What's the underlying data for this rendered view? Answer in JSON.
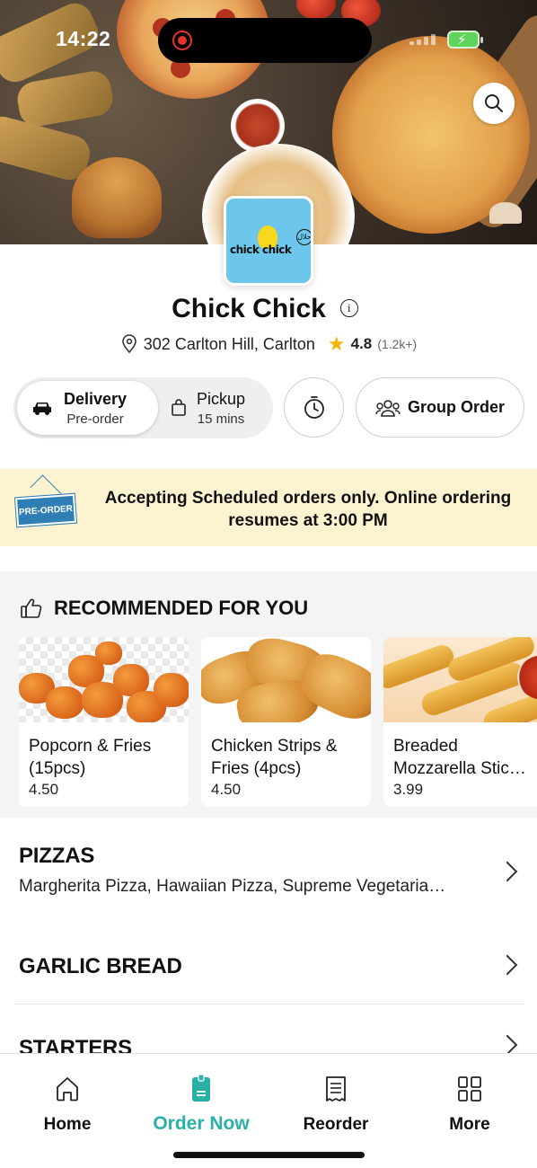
{
  "status_bar": {
    "time": "14:22",
    "battery_state": "charging"
  },
  "hero": {
    "search_icon": "search-icon"
  },
  "restaurant": {
    "logo_text": "chick chick",
    "name": "Chick Chick",
    "address": "302 Carlton Hill, Carlton",
    "rating": "4.8",
    "rating_count": "(1.2k+)"
  },
  "modes": {
    "delivery": {
      "label": "Delivery",
      "sub": "Pre-order"
    },
    "pickup": {
      "label": "Pickup",
      "sub": "15 mins"
    },
    "group_order_label": "Group Order"
  },
  "banner": {
    "sign_text": "PRE-ORDER",
    "message": "Accepting Scheduled orders only. Online ordering resumes at 3:00 PM"
  },
  "recommended": {
    "title": "RECOMMENDED FOR YOU",
    "items": [
      {
        "name_line1": "Popcorn & Fries",
        "name_line2": "(15pcs)",
        "price": "4.50"
      },
      {
        "name_line1": "Chicken Strips &",
        "name_line2": "Fries (4pcs)",
        "price": "4.50"
      },
      {
        "name_line1": "Breaded",
        "name_line2": "Mozzarella Stic…",
        "price": "3.99"
      }
    ]
  },
  "categories": [
    {
      "title": "PIZZAS",
      "subtitle": "Margherita Pizza, Hawaiian Pizza, Supreme Vegetaria…"
    },
    {
      "title": "GARLIC BREAD"
    },
    {
      "title": "STARTERS"
    }
  ],
  "bottom_nav": [
    {
      "label": "Home",
      "icon": "home-icon"
    },
    {
      "label": "Order Now",
      "icon": "order-now-icon",
      "active": true
    },
    {
      "label": "Reorder",
      "icon": "receipt-icon"
    },
    {
      "label": "More",
      "icon": "grid-icon"
    }
  ],
  "colors": {
    "accent": "#2bb0a8",
    "banner_bg": "#fdf3d1",
    "star": "#f4b400"
  }
}
